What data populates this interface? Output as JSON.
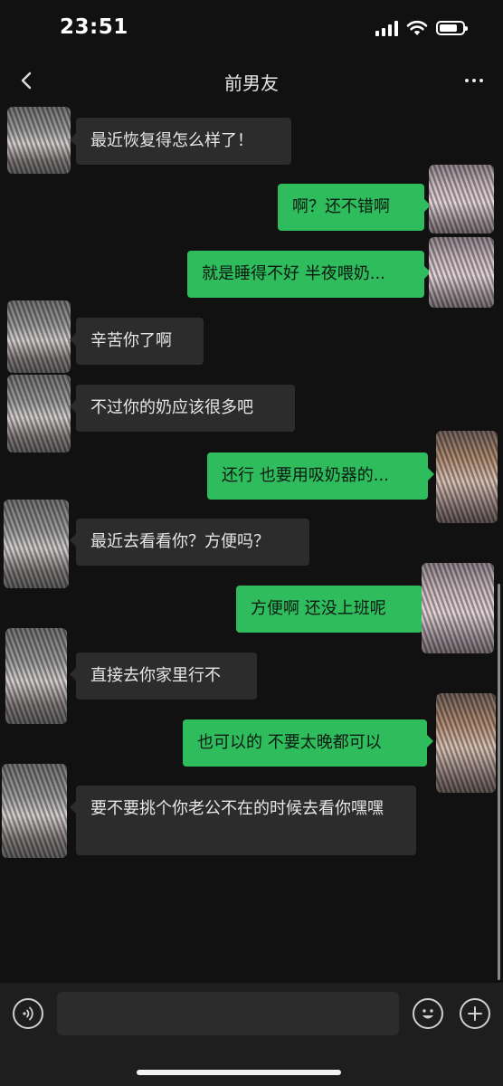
{
  "status_bar": {
    "time": "23:51"
  },
  "header": {
    "title": "前男友"
  },
  "messages": [
    {
      "side": "in",
      "text": "最近恢复得怎么样了！"
    },
    {
      "side": "out",
      "text": "啊？还不错啊"
    },
    {
      "side": "out",
      "text": "就是睡得不好 半夜喂奶..."
    },
    {
      "side": "in",
      "text": "辛苦你了啊"
    },
    {
      "side": "in",
      "text": "不过你的奶应该很多吧"
    },
    {
      "side": "out",
      "text": "还行 也要用吸奶器的..."
    },
    {
      "side": "in",
      "text": "最近去看看你？方便吗？"
    },
    {
      "side": "out",
      "text": "方便啊 还没上班呢"
    },
    {
      "side": "in",
      "text": "直接去你家里行不"
    },
    {
      "side": "out",
      "text": "也可以的 不要太晚都可以"
    },
    {
      "side": "in",
      "text": "要不要挑个你老公不在的时候去看你嘿嘿"
    }
  ],
  "input_bar": {
    "message_value": ""
  },
  "colors": {
    "background": "#111111",
    "incoming_bubble": "#2c2c2c",
    "outgoing_bubble": "#2fbc5d"
  }
}
